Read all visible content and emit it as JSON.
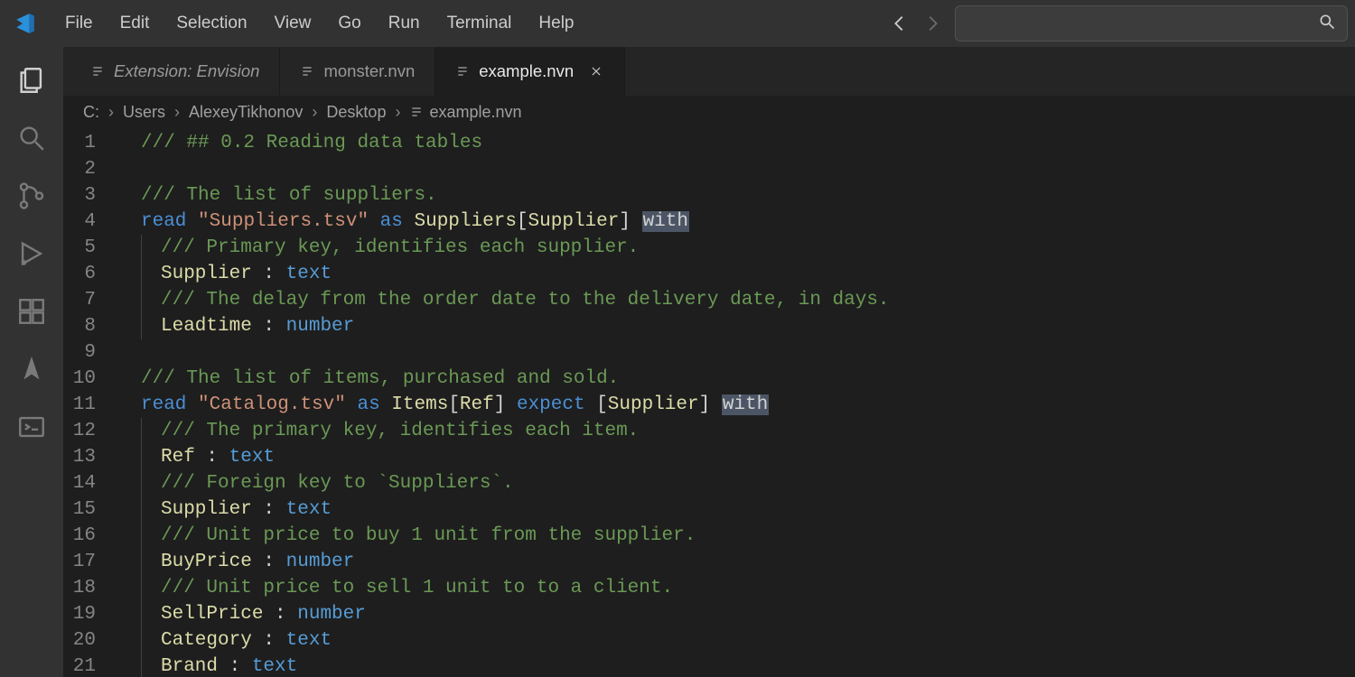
{
  "menu": {
    "items": [
      "File",
      "Edit",
      "Selection",
      "View",
      "Go",
      "Run",
      "Terminal",
      "Help"
    ]
  },
  "tabs": {
    "items": [
      {
        "label": "Extension: Envision",
        "active": false,
        "closeable": false,
        "italic": true
      },
      {
        "label": "monster.nvn",
        "active": false,
        "closeable": false,
        "italic": false
      },
      {
        "label": "example.nvn",
        "active": true,
        "closeable": true,
        "italic": false
      }
    ]
  },
  "breadcrumbs": {
    "parts": [
      "C:",
      "Users",
      "AlexeyTikhonov",
      "Desktop"
    ],
    "file": "example.nvn"
  },
  "code": {
    "lines": [
      {
        "n": 1,
        "indent": 0,
        "tokens": [
          [
            "comment-hdr",
            "/// ## 0.2 Reading data tables"
          ]
        ]
      },
      {
        "n": 2,
        "indent": 0,
        "tokens": []
      },
      {
        "n": 3,
        "indent": 0,
        "tokens": [
          [
            "comment",
            "/// The list of suppliers."
          ]
        ]
      },
      {
        "n": 4,
        "indent": 0,
        "tokens": [
          [
            "kw",
            "read"
          ],
          [
            "punct",
            " "
          ],
          [
            "str",
            "\"Suppliers.tsv\""
          ],
          [
            "punct",
            " "
          ],
          [
            "kw",
            "as"
          ],
          [
            "punct",
            " "
          ],
          [
            "ident",
            "Suppliers"
          ],
          [
            "punct",
            "["
          ],
          [
            "ident",
            "Supplier"
          ],
          [
            "punct",
            "] "
          ],
          [
            "sel",
            "with"
          ]
        ]
      },
      {
        "n": 5,
        "indent": 1,
        "tokens": [
          [
            "comment",
            "/// Primary key, identifies each supplier."
          ]
        ]
      },
      {
        "n": 6,
        "indent": 1,
        "tokens": [
          [
            "ident",
            "Supplier"
          ],
          [
            "punct",
            " : "
          ],
          [
            "type",
            "text"
          ]
        ]
      },
      {
        "n": 7,
        "indent": 1,
        "tokens": [
          [
            "comment",
            "/// The delay from the order date to the delivery date, in days."
          ]
        ]
      },
      {
        "n": 8,
        "indent": 1,
        "tokens": [
          [
            "ident",
            "Leadtime"
          ],
          [
            "punct",
            " : "
          ],
          [
            "type",
            "number"
          ]
        ]
      },
      {
        "n": 9,
        "indent": 0,
        "tokens": []
      },
      {
        "n": 10,
        "indent": 0,
        "tokens": [
          [
            "comment",
            "/// The list of items, purchased and sold."
          ]
        ]
      },
      {
        "n": 11,
        "indent": 0,
        "tokens": [
          [
            "kw",
            "read"
          ],
          [
            "punct",
            " "
          ],
          [
            "str",
            "\"Catalog.tsv\""
          ],
          [
            "punct",
            " "
          ],
          [
            "kw",
            "as"
          ],
          [
            "punct",
            " "
          ],
          [
            "ident",
            "Items"
          ],
          [
            "punct",
            "["
          ],
          [
            "ident",
            "Ref"
          ],
          [
            "punct",
            "] "
          ],
          [
            "kw",
            "expect"
          ],
          [
            "punct",
            " ["
          ],
          [
            "ident",
            "Supplier"
          ],
          [
            "punct",
            "] "
          ],
          [
            "sel",
            "with"
          ]
        ]
      },
      {
        "n": 12,
        "indent": 1,
        "tokens": [
          [
            "comment",
            "/// The primary key, identifies each item."
          ]
        ]
      },
      {
        "n": 13,
        "indent": 1,
        "tokens": [
          [
            "ident",
            "Ref"
          ],
          [
            "punct",
            " : "
          ],
          [
            "type",
            "text"
          ]
        ]
      },
      {
        "n": 14,
        "indent": 1,
        "tokens": [
          [
            "comment",
            "/// Foreign key to `Suppliers`."
          ]
        ]
      },
      {
        "n": 15,
        "indent": 1,
        "tokens": [
          [
            "ident",
            "Supplier"
          ],
          [
            "punct",
            " : "
          ],
          [
            "type",
            "text"
          ]
        ]
      },
      {
        "n": 16,
        "indent": 1,
        "tokens": [
          [
            "comment",
            "/// Unit price to buy 1 unit from the supplier."
          ]
        ]
      },
      {
        "n": 17,
        "indent": 1,
        "tokens": [
          [
            "ident",
            "BuyPrice"
          ],
          [
            "punct",
            " : "
          ],
          [
            "type",
            "number"
          ]
        ]
      },
      {
        "n": 18,
        "indent": 1,
        "tokens": [
          [
            "comment",
            "/// Unit price to sell 1 unit to to a client."
          ]
        ]
      },
      {
        "n": 19,
        "indent": 1,
        "tokens": [
          [
            "ident",
            "SellPrice"
          ],
          [
            "punct",
            " : "
          ],
          [
            "type",
            "number"
          ]
        ]
      },
      {
        "n": 20,
        "indent": 1,
        "tokens": [
          [
            "ident",
            "Category"
          ],
          [
            "punct",
            " : "
          ],
          [
            "type",
            "text"
          ]
        ]
      },
      {
        "n": 21,
        "indent": 1,
        "tokens": [
          [
            "ident",
            "Brand"
          ],
          [
            "punct",
            " : "
          ],
          [
            "type",
            "text"
          ]
        ]
      }
    ]
  },
  "activity": {
    "items": [
      "files-icon",
      "search-icon",
      "source-control-icon",
      "run-debug-icon",
      "extensions-icon",
      "rocket-icon",
      "terminal-icon"
    ]
  }
}
